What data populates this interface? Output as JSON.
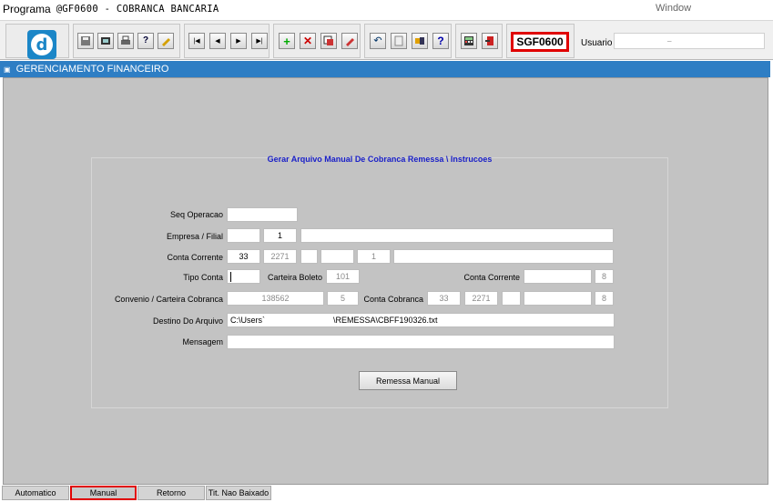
{
  "titlebar": {
    "label": "Programa",
    "program": "@GF0600 - COBRANCA BANCARIA",
    "window_menu": "Window"
  },
  "toolbar": {
    "icons": [
      "save-icon",
      "print-preview-icon",
      "print-icon",
      "help-query-icon",
      "edit-icon",
      "first-record-icon",
      "previous-record-icon",
      "next-record-icon",
      "last-record-icon",
      "insert-record-icon",
      "delete-record-icon",
      "duplicate-record-icon",
      "edit-record-icon",
      "undo-icon",
      "clipboard-icon",
      "export-icon",
      "help-icon",
      "calculator-icon",
      "exit-icon"
    ],
    "form_code": "SGF0600",
    "user_label": "Usuario",
    "user_value": "_"
  },
  "header": {
    "title": "GERENCIAMENTO FINANCEIRO"
  },
  "form": {
    "title": "Gerar Arquivo Manual De Cobranca Remessa \\ Instrucoes",
    "labels": {
      "seq_operacao": "Seq Operacao",
      "empresa_filial": "Empresa / Filial",
      "conta_corrente": "Conta Corrente",
      "tipo_conta": "Tipo Conta",
      "carteira_boleto": "Carteira Boleto",
      "conta_corrente_2": "Conta Corrente",
      "convenio": "Convenio / Carteira Cobranca",
      "conta_cobranca": "Conta Cobranca",
      "destino": "Destino Do Arquivo",
      "mensagem": "Mensagem"
    },
    "values": {
      "seq_operacao": "",
      "empresa": "",
      "filial": "1",
      "empresa_nome": "",
      "cc_banco": "33",
      "cc_agencia": "2271",
      "cc_dig": "",
      "cc_conta": "",
      "cc_dig2": "1",
      "cc_nome": "",
      "tipo_conta": "",
      "carteira_boleto": "101",
      "cc2_conta": "",
      "cc2_dig": "8",
      "convenio": "138562",
      "carteira": "5",
      "cob_banco": "33",
      "cob_agencia": "2271",
      "cob_dig": "",
      "cob_conta": "",
      "cob_dig2": "8",
      "destino_a": "C:\\Users`",
      "destino_b": "\\REMESSA\\CBFF190326.txt",
      "mensagem": ""
    },
    "button": "Remessa Manual"
  },
  "tabs": [
    {
      "label": "Automatico",
      "active": false
    },
    {
      "label": "Manual",
      "active": true
    },
    {
      "label": "Retorno",
      "active": false
    },
    {
      "label": "Tit. Nao Baixado",
      "active": false
    }
  ],
  "colors": {
    "header": "#2e7ec4",
    "title": "#1a20c8",
    "highlight": "#e00000"
  }
}
